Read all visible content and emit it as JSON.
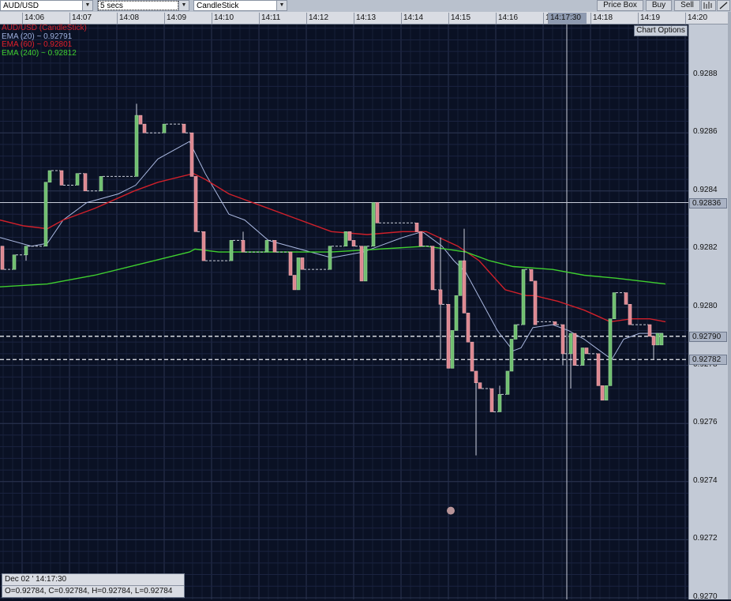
{
  "toolbar": {
    "symbol": "AUD/USD",
    "interval": "5 secs",
    "chart_type": "CandleStick",
    "price_box": "Price Box",
    "buy": "Buy",
    "sell": "Sell",
    "bar_icon": "bar-chart-icon",
    "line_icon": "draw-line-icon"
  },
  "time_axis": {
    "labels": [
      "14:06",
      "14:07",
      "14:08",
      "14:09",
      "14:10",
      "14:11",
      "14:12",
      "14:13",
      "14:14",
      "14:15",
      "14:16",
      "14:17",
      "14:18",
      "14:19",
      "14:20"
    ],
    "cursor_label": "14:17:30"
  },
  "legend": {
    "title": "AUD/USD (CandleStick)",
    "ema20": "EMA (20) ~ 0.92791",
    "ema60": "EMA (60) ~ 0.92801",
    "ema240": "EMA (240) ~ 0.92812"
  },
  "chart_options": "Chart Options",
  "price_axis": {
    "labels": [
      "0.9288",
      "0.9286",
      "0.9284",
      "0.9282",
      "0.9280",
      "0.9278",
      "0.9276",
      "0.9274",
      "0.9272",
      "0.9270"
    ],
    "marker_solid": "0.92836",
    "marker_dash1": "0.92790",
    "marker_dash2": "0.92782"
  },
  "info": {
    "date": "Dec 02 ' 14:17:30",
    "ohlc": "O=0.92784, C=0.92784, H=0.92784, L=0.92784"
  },
  "colors": {
    "bg": "#0a1124",
    "up": "#6fbf6f",
    "down": "#dd8790",
    "ema20": "#aab8e0",
    "ema60": "#d0202a",
    "ema240": "#3fcf2f"
  },
  "chart_data": {
    "type": "candlestick",
    "ylim": [
      0.927,
      0.929
    ],
    "xlim": [
      "14:05:32",
      "14:20:04"
    ],
    "cursor_time": "14:17:30",
    "solid_level": 0.92836,
    "dashed_levels": [
      0.9279,
      0.92782
    ],
    "marker_point": {
      "t": "14:15:03",
      "price": 0.9273
    },
    "candles": [
      [
        "14:05:35",
        0.92821,
        0.92821,
        0.92813,
        0.92813
      ],
      [
        "14:05:50",
        0.92813,
        0.92818,
        0.92813,
        0.92818
      ],
      [
        "14:06:05",
        0.92818,
        0.92821,
        0.92816,
        0.92821
      ],
      [
        "14:06:30",
        0.92821,
        0.92843,
        0.92821,
        0.92843
      ],
      [
        "14:06:35",
        0.92843,
        0.92847,
        0.92843,
        0.92847
      ],
      [
        "14:06:50",
        0.92847,
        0.92847,
        0.92842,
        0.92842
      ],
      [
        "14:07:10",
        0.92842,
        0.92846,
        0.92842,
        0.92846
      ],
      [
        "14:07:20",
        0.92846,
        0.92846,
        0.9284,
        0.9284
      ],
      [
        "14:07:40",
        0.9284,
        0.92845,
        0.9284,
        0.92845
      ],
      [
        "14:08:25",
        0.92845,
        0.9287,
        0.92845,
        0.92866
      ],
      [
        "14:08:30",
        0.92866,
        0.92866,
        0.92863,
        0.92863
      ],
      [
        "14:08:35",
        0.92863,
        0.92863,
        0.9286,
        0.9286
      ],
      [
        "14:09:00",
        0.9286,
        0.92863,
        0.9286,
        0.92863
      ],
      [
        "14:09:25",
        0.92863,
        0.92863,
        0.9286,
        0.9286
      ],
      [
        "14:09:35",
        0.9286,
        0.9286,
        0.92845,
        0.92845
      ],
      [
        "14:09:40",
        0.92845,
        0.92845,
        0.92826,
        0.92826
      ],
      [
        "14:09:50",
        0.92826,
        0.92826,
        0.92816,
        0.92816
      ],
      [
        "14:10:25",
        0.92816,
        0.92823,
        0.92816,
        0.92823
      ],
      [
        "14:10:40",
        0.92823,
        0.92826,
        0.92819,
        0.92819
      ],
      [
        "14:11:10",
        0.92819,
        0.92823,
        0.92819,
        0.92823
      ],
      [
        "14:11:20",
        0.92823,
        0.92823,
        0.92819,
        0.92819
      ],
      [
        "14:11:40",
        0.92819,
        0.92819,
        0.92811,
        0.92811
      ],
      [
        "14:11:45",
        0.92811,
        0.92811,
        0.92806,
        0.92806
      ],
      [
        "14:11:50",
        0.92806,
        0.92817,
        0.92806,
        0.92817
      ],
      [
        "14:11:55",
        0.92817,
        0.92817,
        0.92813,
        0.92813
      ],
      [
        "14:12:30",
        0.92813,
        0.92821,
        0.92813,
        0.92821
      ],
      [
        "14:12:50",
        0.92821,
        0.92826,
        0.92821,
        0.92826
      ],
      [
        "14:12:55",
        0.92826,
        0.92826,
        0.92823,
        0.92823
      ],
      [
        "14:13:00",
        0.92823,
        0.92823,
        0.92821,
        0.92821
      ],
      [
        "14:13:10",
        0.92821,
        0.92821,
        0.92809,
        0.92809
      ],
      [
        "14:13:15",
        0.92809,
        0.92821,
        0.92809,
        0.92821
      ],
      [
        "14:13:25",
        0.92821,
        0.92836,
        0.92821,
        0.92836
      ],
      [
        "14:13:30",
        0.92836,
        0.92836,
        0.92829,
        0.92829
      ],
      [
        "14:14:20",
        0.92829,
        0.92829,
        0.92826,
        0.92826
      ],
      [
        "14:14:25",
        0.92826,
        0.92826,
        0.92821,
        0.92821
      ],
      [
        "14:14:40",
        0.92821,
        0.92821,
        0.92806,
        0.92806
      ],
      [
        "14:14:50",
        0.92806,
        0.92824,
        0.92782,
        0.92801
      ],
      [
        "14:15:00",
        0.92801,
        0.92801,
        0.92779,
        0.92779
      ],
      [
        "14:15:05",
        0.92779,
        0.92792,
        0.92779,
        0.92792
      ],
      [
        "14:15:10",
        0.92792,
        0.92804,
        0.92792,
        0.92804
      ],
      [
        "14:15:15",
        0.92804,
        0.92816,
        0.92804,
        0.92816
      ],
      [
        "14:15:20",
        0.92816,
        0.92827,
        0.92798,
        0.92798
      ],
      [
        "14:15:25",
        0.92798,
        0.92798,
        0.92788,
        0.92788
      ],
      [
        "14:15:30",
        0.92788,
        0.92788,
        0.92778,
        0.92778
      ],
      [
        "14:15:35",
        0.92778,
        0.92778,
        0.92749,
        0.92774
      ],
      [
        "14:15:40",
        0.92774,
        0.92774,
        0.92772,
        0.92772
      ],
      [
        "14:15:55",
        0.92772,
        0.92772,
        0.92764,
        0.92764
      ],
      [
        "14:16:05",
        0.92764,
        0.92773,
        0.92764,
        0.9277
      ],
      [
        "14:16:15",
        0.9277,
        0.92778,
        0.9277,
        0.92778
      ],
      [
        "14:16:20",
        0.92778,
        0.92789,
        0.92778,
        0.92789
      ],
      [
        "14:16:25",
        0.92789,
        0.92794,
        0.92789,
        0.92794
      ],
      [
        "14:16:35",
        0.92794,
        0.92813,
        0.92794,
        0.92813
      ],
      [
        "14:16:45",
        0.92813,
        0.92813,
        0.92809,
        0.92809
      ],
      [
        "14:16:50",
        0.92809,
        0.92809,
        0.92794,
        0.92794
      ],
      [
        "14:17:15",
        0.92795,
        0.92795,
        0.92794,
        0.92794
      ],
      [
        "14:17:25",
        0.92794,
        0.92794,
        0.9278,
        0.92784
      ],
      [
        "14:17:35",
        0.92784,
        0.92791,
        0.92772,
        0.92791
      ],
      [
        "14:17:40",
        0.92791,
        0.92791,
        0.9278,
        0.9278
      ],
      [
        "14:17:50",
        0.9278,
        0.92786,
        0.9278,
        0.92786
      ],
      [
        "14:17:55",
        0.92786,
        0.92786,
        0.92784,
        0.92784
      ],
      [
        "14:18:10",
        0.92784,
        0.92784,
        0.92773,
        0.92773
      ],
      [
        "14:18:15",
        0.92773,
        0.92773,
        0.92768,
        0.92768
      ],
      [
        "14:18:20",
        0.92768,
        0.92773,
        0.92768,
        0.92773
      ],
      [
        "14:18:25",
        0.92773,
        0.92796,
        0.92773,
        0.92796
      ],
      [
        "14:18:30",
        0.92796,
        0.92805,
        0.92796,
        0.92805
      ],
      [
        "14:18:45",
        0.92805,
        0.92805,
        0.92801,
        0.92801
      ],
      [
        "14:18:50",
        0.92801,
        0.92801,
        0.92794,
        0.92794
      ],
      [
        "14:19:15",
        0.92794,
        0.92794,
        0.9279,
        0.9279
      ],
      [
        "14:19:20",
        0.9279,
        0.9279,
        0.92782,
        0.92787
      ],
      [
        "14:19:25",
        0.92787,
        0.92791,
        0.92787,
        0.92791
      ],
      [
        "14:19:30",
        0.92787,
        0.92791,
        0.92787,
        0.92791
      ]
    ],
    "series": [
      {
        "name": "EMA (20)",
        "points": [
          [
            "14:05:32",
            0.92824
          ],
          [
            "14:06:12",
            0.92821
          ],
          [
            "14:06:32",
            0.92822
          ],
          [
            "14:06:52",
            0.9283
          ],
          [
            "14:07:22",
            0.92836
          ],
          [
            "14:08:02",
            0.92839
          ],
          [
            "14:08:24",
            0.92842
          ],
          [
            "14:08:52",
            0.92851
          ],
          [
            "14:09:32",
            0.92857
          ],
          [
            "14:09:52",
            0.92846
          ],
          [
            "14:10:22",
            0.92832
          ],
          [
            "14:10:42",
            0.9283
          ],
          [
            "14:11:12",
            0.92823
          ],
          [
            "14:11:52",
            0.9282
          ],
          [
            "14:12:32",
            0.92817
          ],
          [
            "14:13:12",
            0.92819
          ],
          [
            "14:13:32",
            0.92821
          ],
          [
            "14:14:02",
            0.92824
          ],
          [
            "14:14:27",
            0.92826
          ],
          [
            "14:14:52",
            0.92821
          ],
          [
            "14:15:07",
            0.92816
          ],
          [
            "14:15:22",
            0.92812
          ],
          [
            "14:15:42",
            0.92802
          ],
          [
            "14:16:02",
            0.92792
          ],
          [
            "14:16:22",
            0.92785
          ],
          [
            "14:16:32",
            0.92786
          ],
          [
            "14:16:47",
            0.92793
          ],
          [
            "14:17:12",
            0.92794
          ],
          [
            "14:17:32",
            0.92792
          ],
          [
            "14:17:52",
            0.92789
          ],
          [
            "14:18:12",
            0.92785
          ],
          [
            "14:18:27",
            0.92782
          ],
          [
            "14:18:42",
            0.92789
          ],
          [
            "14:19:02",
            0.92791
          ],
          [
            "14:19:32",
            0.92791
          ]
        ]
      },
      {
        "name": "EMA (60)",
        "points": [
          [
            "14:05:32",
            0.9283
          ],
          [
            "14:06:02",
            0.92828
          ],
          [
            "14:06:32",
            0.92827
          ],
          [
            "14:06:52",
            0.9283
          ],
          [
            "14:07:32",
            0.92834
          ],
          [
            "14:08:22",
            0.9284
          ],
          [
            "14:08:52",
            0.92843
          ],
          [
            "14:09:37",
            0.92846
          ],
          [
            "14:09:52",
            0.92844
          ],
          [
            "14:10:22",
            0.92839
          ],
          [
            "14:11:02",
            0.92835
          ],
          [
            "14:11:52",
            0.9283
          ],
          [
            "14:12:32",
            0.92826
          ],
          [
            "14:13:17",
            0.92825
          ],
          [
            "14:14:02",
            0.92826
          ],
          [
            "14:14:32",
            0.92826
          ],
          [
            "14:15:12",
            0.92821
          ],
          [
            "14:15:39",
            0.92816
          ],
          [
            "14:16:12",
            0.92806
          ],
          [
            "14:16:39",
            0.92804
          ],
          [
            "14:16:49",
            0.92804
          ],
          [
            "14:17:19",
            0.92802
          ],
          [
            "14:17:52",
            0.92799
          ],
          [
            "14:18:25",
            0.92795
          ],
          [
            "14:18:52",
            0.92796
          ],
          [
            "14:19:15",
            0.92796
          ],
          [
            "14:19:35",
            0.92795
          ]
        ]
      },
      {
        "name": "EMA (240)",
        "points": [
          [
            "14:05:32",
            0.92807
          ],
          [
            "14:06:32",
            0.92808
          ],
          [
            "14:07:32",
            0.92811
          ],
          [
            "14:08:32",
            0.92815
          ],
          [
            "14:09:32",
            0.92819
          ],
          [
            "14:09:39",
            0.9282
          ],
          [
            "14:10:09",
            0.92819
          ],
          [
            "14:12:32",
            0.92819
          ],
          [
            "14:14:32",
            0.92821
          ],
          [
            "14:15:22",
            0.92819
          ],
          [
            "14:15:52",
            0.92816
          ],
          [
            "14:16:22",
            0.92814
          ],
          [
            "14:17:12",
            0.92813
          ],
          [
            "14:17:52",
            0.92811
          ],
          [
            "14:18:32",
            0.9281
          ],
          [
            "14:19:35",
            0.92808
          ]
        ]
      }
    ]
  }
}
